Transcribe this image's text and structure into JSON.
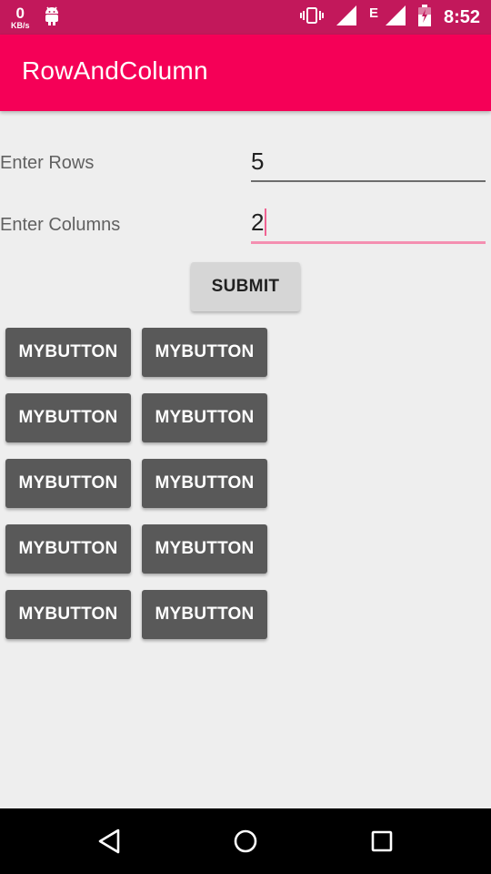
{
  "status_bar": {
    "speed_value": "0",
    "speed_unit": "KB/s",
    "network_type": "E",
    "time": "8:52",
    "icons": [
      "android-icon",
      "vibrate-icon",
      "signal-icon",
      "signal-icon",
      "battery-charging-icon"
    ]
  },
  "app_bar": {
    "title": "RowAndColumn",
    "color": "#f50057"
  },
  "form": {
    "rows_label": "Enter Rows",
    "rows_value": "5",
    "columns_label": "Enter Columns",
    "columns_value": "2",
    "submit_label": "SUBMIT"
  },
  "grid": {
    "rows": 5,
    "columns": 2,
    "buttons": [
      [
        "MYBUTTON",
        "MYBUTTON"
      ],
      [
        "MYBUTTON",
        "MYBUTTON"
      ],
      [
        "MYBUTTON",
        "MYBUTTON"
      ],
      [
        "MYBUTTON",
        "MYBUTTON"
      ],
      [
        "MYBUTTON",
        "MYBUTTON"
      ]
    ]
  },
  "nav_bar": {
    "icons": [
      "back-icon",
      "home-icon",
      "recents-icon"
    ]
  }
}
